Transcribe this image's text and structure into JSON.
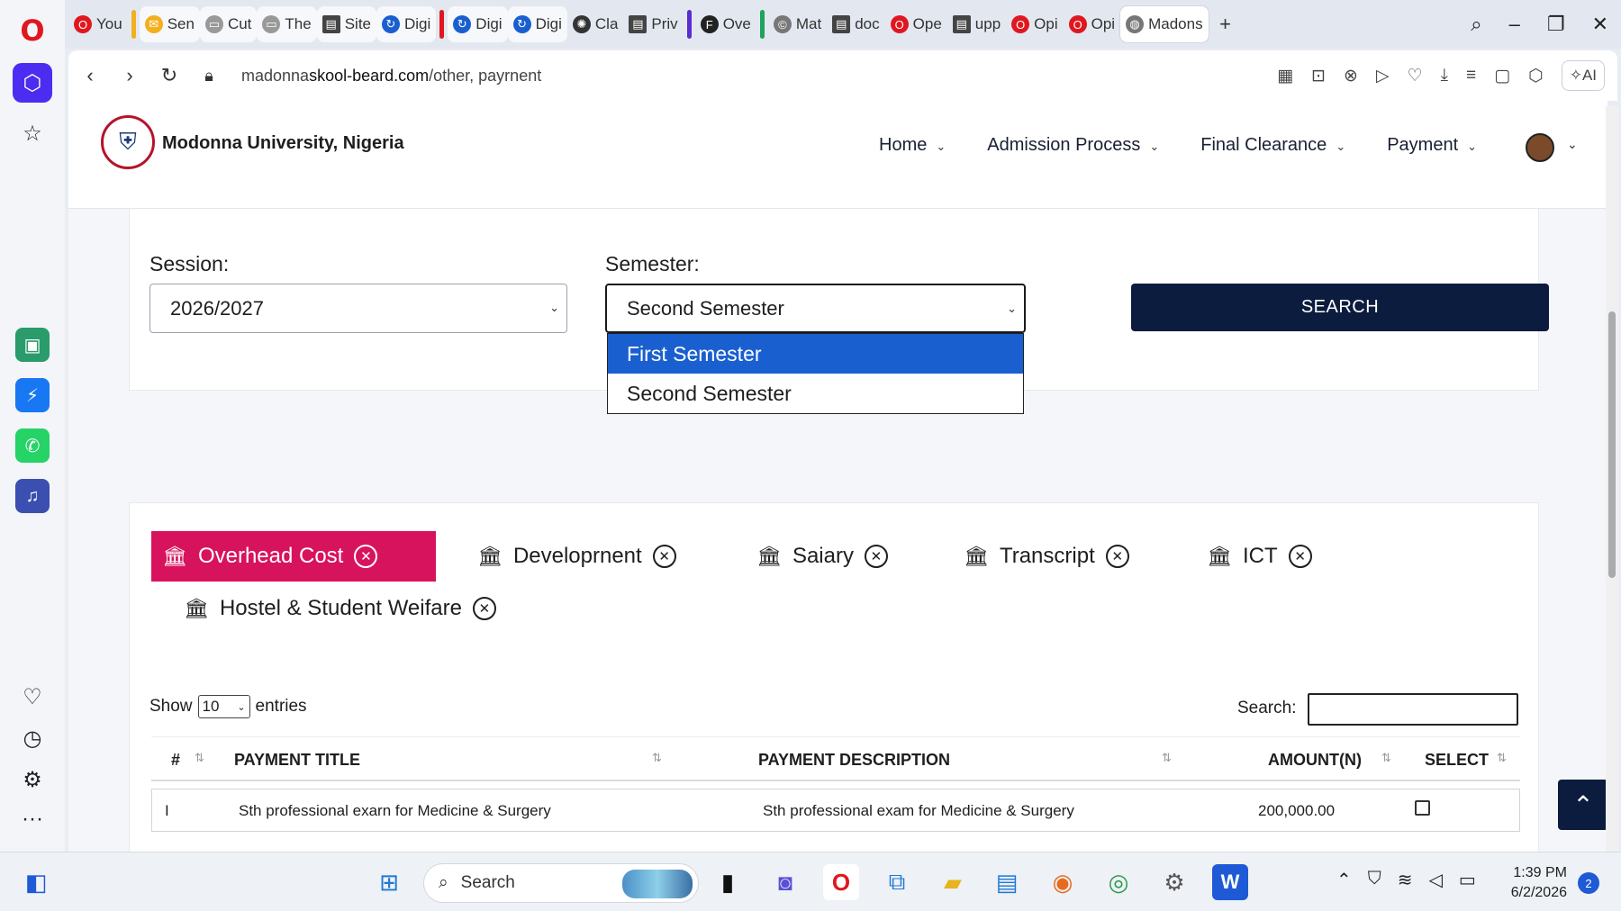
{
  "browser": {
    "tabs": [
      {
        "label": "You",
        "icon_color": "#e0171f"
      },
      {
        "label": "Sen",
        "icon_color": "#f2b01e"
      },
      {
        "label": "Cut",
        "icon_color": "#888888"
      },
      {
        "label": "The",
        "icon_color": "#888888"
      },
      {
        "label": "Site",
        "icon_color": "#444444"
      },
      {
        "label": "Digi",
        "icon_color": "#1a5fd0"
      },
      {
        "label": "Digi",
        "icon_color": "#1a5fd0"
      },
      {
        "label": "Digi",
        "icon_color": "#1a5fd0"
      },
      {
        "label": "Cla",
        "icon_color": "#333333"
      },
      {
        "label": "Priv",
        "icon_color": "#444444"
      },
      {
        "label": "Ove",
        "icon_color": "#222222"
      },
      {
        "label": "Mat",
        "icon_color": "#666666"
      },
      {
        "label": "doc",
        "icon_color": "#444444"
      },
      {
        "label": "Ope",
        "icon_color": "#e0171f"
      },
      {
        "label": "upp",
        "icon_color": "#444444"
      },
      {
        "label": "Opi",
        "icon_color": "#e0171f"
      },
      {
        "label": "Opi",
        "icon_color": "#e0171f"
      },
      {
        "label": "Madons",
        "icon_color": "#666666"
      }
    ],
    "url_prefix": "madonna",
    "url_domain": "skool-beard.com",
    "url_path": "/other, payrnent",
    "ai_label": "AI"
  },
  "site": {
    "name": "Modonna University, Nigeria",
    "nav": [
      "Home",
      "Admission Process",
      "Final Clearance",
      "Payment"
    ]
  },
  "form": {
    "session_label": "Session:",
    "session_value": "2026/2027",
    "semester_label": "Semester:",
    "semester_value": "Second Semester",
    "search_button": "SEARCH",
    "dropdown_options": [
      "First Semester",
      "Second Semester"
    ]
  },
  "categories": [
    "Overhead Cost",
    "Developrnent",
    "Saiary",
    "Transcript",
    "ICT",
    "Hostel & Student Weifare"
  ],
  "table": {
    "show_label": "Show",
    "entries_value": "10",
    "entries_label": "entries",
    "search_label": "Search:",
    "headers": [
      "#",
      "PAYMENT TITLE",
      "PAYMENT DESCRIPTION",
      "AMOUNT(N)",
      "SELECT"
    ],
    "rows": [
      {
        "num": "I",
        "title": "Sth professional exarn for Medicine & Surgery",
        "description": "Sth professional exam for Medicine & Surgery",
        "amount": "200,000.00"
      }
    ]
  },
  "taskbar": {
    "search_label": "Search",
    "time": "1:39 PM",
    "date": "6/2/2026",
    "notifications": "2"
  },
  "colors": {
    "accent_pink": "#d8135d",
    "navy": "#0c1c3e",
    "dropdown_highlight": "#1a5fd0"
  }
}
